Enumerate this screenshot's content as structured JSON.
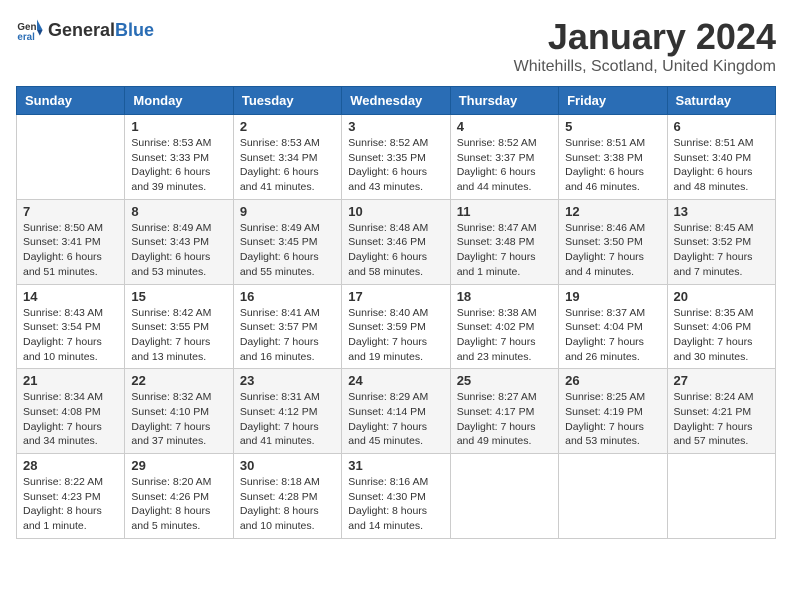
{
  "header": {
    "logo_general": "General",
    "logo_blue": "Blue",
    "month": "January 2024",
    "location": "Whitehills, Scotland, United Kingdom"
  },
  "days_of_week": [
    "Sunday",
    "Monday",
    "Tuesday",
    "Wednesday",
    "Thursday",
    "Friday",
    "Saturday"
  ],
  "weeks": [
    [
      {
        "day": "",
        "sunrise": "",
        "sunset": "",
        "daylight": ""
      },
      {
        "day": "1",
        "sunrise": "Sunrise: 8:53 AM",
        "sunset": "Sunset: 3:33 PM",
        "daylight": "Daylight: 6 hours and 39 minutes."
      },
      {
        "day": "2",
        "sunrise": "Sunrise: 8:53 AM",
        "sunset": "Sunset: 3:34 PM",
        "daylight": "Daylight: 6 hours and 41 minutes."
      },
      {
        "day": "3",
        "sunrise": "Sunrise: 8:52 AM",
        "sunset": "Sunset: 3:35 PM",
        "daylight": "Daylight: 6 hours and 43 minutes."
      },
      {
        "day": "4",
        "sunrise": "Sunrise: 8:52 AM",
        "sunset": "Sunset: 3:37 PM",
        "daylight": "Daylight: 6 hours and 44 minutes."
      },
      {
        "day": "5",
        "sunrise": "Sunrise: 8:51 AM",
        "sunset": "Sunset: 3:38 PM",
        "daylight": "Daylight: 6 hours and 46 minutes."
      },
      {
        "day": "6",
        "sunrise": "Sunrise: 8:51 AM",
        "sunset": "Sunset: 3:40 PM",
        "daylight": "Daylight: 6 hours and 48 minutes."
      }
    ],
    [
      {
        "day": "7",
        "sunrise": "Sunrise: 8:50 AM",
        "sunset": "Sunset: 3:41 PM",
        "daylight": "Daylight: 6 hours and 51 minutes."
      },
      {
        "day": "8",
        "sunrise": "Sunrise: 8:49 AM",
        "sunset": "Sunset: 3:43 PM",
        "daylight": "Daylight: 6 hours and 53 minutes."
      },
      {
        "day": "9",
        "sunrise": "Sunrise: 8:49 AM",
        "sunset": "Sunset: 3:45 PM",
        "daylight": "Daylight: 6 hours and 55 minutes."
      },
      {
        "day": "10",
        "sunrise": "Sunrise: 8:48 AM",
        "sunset": "Sunset: 3:46 PM",
        "daylight": "Daylight: 6 hours and 58 minutes."
      },
      {
        "day": "11",
        "sunrise": "Sunrise: 8:47 AM",
        "sunset": "Sunset: 3:48 PM",
        "daylight": "Daylight: 7 hours and 1 minute."
      },
      {
        "day": "12",
        "sunrise": "Sunrise: 8:46 AM",
        "sunset": "Sunset: 3:50 PM",
        "daylight": "Daylight: 7 hours and 4 minutes."
      },
      {
        "day": "13",
        "sunrise": "Sunrise: 8:45 AM",
        "sunset": "Sunset: 3:52 PM",
        "daylight": "Daylight: 7 hours and 7 minutes."
      }
    ],
    [
      {
        "day": "14",
        "sunrise": "Sunrise: 8:43 AM",
        "sunset": "Sunset: 3:54 PM",
        "daylight": "Daylight: 7 hours and 10 minutes."
      },
      {
        "day": "15",
        "sunrise": "Sunrise: 8:42 AM",
        "sunset": "Sunset: 3:55 PM",
        "daylight": "Daylight: 7 hours and 13 minutes."
      },
      {
        "day": "16",
        "sunrise": "Sunrise: 8:41 AM",
        "sunset": "Sunset: 3:57 PM",
        "daylight": "Daylight: 7 hours and 16 minutes."
      },
      {
        "day": "17",
        "sunrise": "Sunrise: 8:40 AM",
        "sunset": "Sunset: 3:59 PM",
        "daylight": "Daylight: 7 hours and 19 minutes."
      },
      {
        "day": "18",
        "sunrise": "Sunrise: 8:38 AM",
        "sunset": "Sunset: 4:02 PM",
        "daylight": "Daylight: 7 hours and 23 minutes."
      },
      {
        "day": "19",
        "sunrise": "Sunrise: 8:37 AM",
        "sunset": "Sunset: 4:04 PM",
        "daylight": "Daylight: 7 hours and 26 minutes."
      },
      {
        "day": "20",
        "sunrise": "Sunrise: 8:35 AM",
        "sunset": "Sunset: 4:06 PM",
        "daylight": "Daylight: 7 hours and 30 minutes."
      }
    ],
    [
      {
        "day": "21",
        "sunrise": "Sunrise: 8:34 AM",
        "sunset": "Sunset: 4:08 PM",
        "daylight": "Daylight: 7 hours and 34 minutes."
      },
      {
        "day": "22",
        "sunrise": "Sunrise: 8:32 AM",
        "sunset": "Sunset: 4:10 PM",
        "daylight": "Daylight: 7 hours and 37 minutes."
      },
      {
        "day": "23",
        "sunrise": "Sunrise: 8:31 AM",
        "sunset": "Sunset: 4:12 PM",
        "daylight": "Daylight: 7 hours and 41 minutes."
      },
      {
        "day": "24",
        "sunrise": "Sunrise: 8:29 AM",
        "sunset": "Sunset: 4:14 PM",
        "daylight": "Daylight: 7 hours and 45 minutes."
      },
      {
        "day": "25",
        "sunrise": "Sunrise: 8:27 AM",
        "sunset": "Sunset: 4:17 PM",
        "daylight": "Daylight: 7 hours and 49 minutes."
      },
      {
        "day": "26",
        "sunrise": "Sunrise: 8:25 AM",
        "sunset": "Sunset: 4:19 PM",
        "daylight": "Daylight: 7 hours and 53 minutes."
      },
      {
        "day": "27",
        "sunrise": "Sunrise: 8:24 AM",
        "sunset": "Sunset: 4:21 PM",
        "daylight": "Daylight: 7 hours and 57 minutes."
      }
    ],
    [
      {
        "day": "28",
        "sunrise": "Sunrise: 8:22 AM",
        "sunset": "Sunset: 4:23 PM",
        "daylight": "Daylight: 8 hours and 1 minute."
      },
      {
        "day": "29",
        "sunrise": "Sunrise: 8:20 AM",
        "sunset": "Sunset: 4:26 PM",
        "daylight": "Daylight: 8 hours and 5 minutes."
      },
      {
        "day": "30",
        "sunrise": "Sunrise: 8:18 AM",
        "sunset": "Sunset: 4:28 PM",
        "daylight": "Daylight: 8 hours and 10 minutes."
      },
      {
        "day": "31",
        "sunrise": "Sunrise: 8:16 AM",
        "sunset": "Sunset: 4:30 PM",
        "daylight": "Daylight: 8 hours and 14 minutes."
      },
      {
        "day": "",
        "sunrise": "",
        "sunset": "",
        "daylight": ""
      },
      {
        "day": "",
        "sunrise": "",
        "sunset": "",
        "daylight": ""
      },
      {
        "day": "",
        "sunrise": "",
        "sunset": "",
        "daylight": ""
      }
    ]
  ]
}
